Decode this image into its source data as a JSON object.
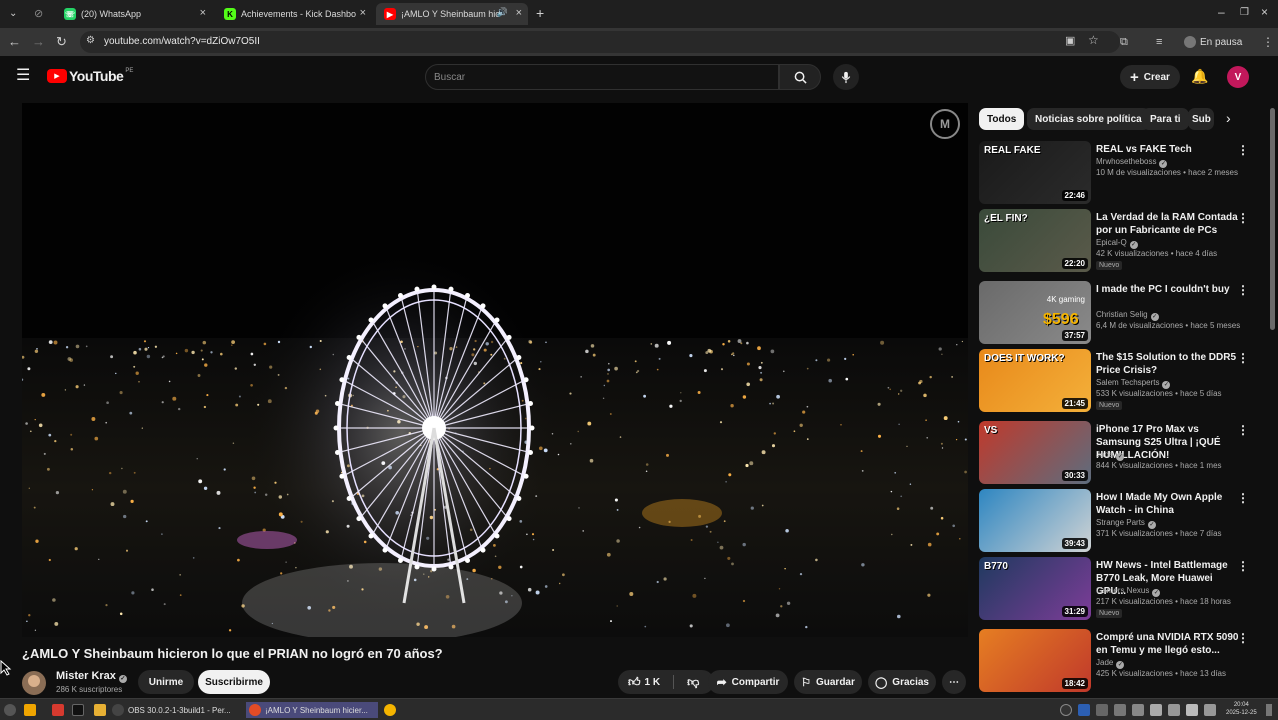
{
  "browser": {
    "tabs": [
      {
        "title": "(20) WhatsApp",
        "color": "#25d366"
      },
      {
        "title": "Achievements - Kick Dashbo",
        "color": "#53fc18"
      },
      {
        "title": "¡AMLO Y Sheinbaum hic",
        "color": "#ff0000",
        "active": true
      }
    ],
    "new_tab": "+",
    "url": "youtube.com/watch?v=dZiOw7O5II",
    "profile_status": "En pausa"
  },
  "youtube": {
    "logo_text": "YouTube",
    "logo_region": "PE",
    "search_placeholder": "Buscar",
    "create_label": "Crear",
    "avatar_letter": "V",
    "chips": [
      "Todos",
      "Noticias sobre política",
      "Para ti",
      "Sub"
    ]
  },
  "video": {
    "title": "¿AMLO Y Sheinbaum hicieron lo que el PRIAN no logró en 70 años?",
    "channel": "Mister Krax",
    "subscribers": "286 K suscriptores",
    "join_label": "Unirme",
    "subscribe_label": "Suscribirme",
    "likes": "1 K",
    "share_label": "Compartir",
    "save_label": "Guardar",
    "thanks_label": "Gracias"
  },
  "recommendations": [
    {
      "title": "REAL vs FAKE Tech",
      "channel": "Mrwhosetheboss",
      "meta": "10 M de visualizaciones • hace 2 meses",
      "duration": "22:46",
      "new": "",
      "thumb_text": "REAL FAKE",
      "thumb_colors": [
        "#1a1a1a",
        "#2b2b2b"
      ]
    },
    {
      "title": "La Verdad de la RAM Contada por un Fabricante de PCs",
      "channel": "Epical-Q",
      "meta": "42 K visualizaciones • hace 4 días",
      "duration": "22:20",
      "new": "Nuevo",
      "thumb_text": "¿EL FIN?",
      "thumb_colors": [
        "#3a4a3a",
        "#5a5a4a"
      ]
    },
    {
      "title": "I made the PC I couldn't buy",
      "channel": "Christian Selig",
      "meta": "6,4 M de visualizaciones • hace 5 meses",
      "duration": "37:57",
      "new": "",
      "thumb_text": "$596",
      "thumb_sub": "4K gaming",
      "thumb_colors": [
        "#6a6a6a",
        "#8a8a8a"
      ]
    },
    {
      "title": "The $15 Solution to the DDR5 Price Crisis?",
      "channel": "Salem Techsperts",
      "meta": "533 K visualizaciones • hace 5 días",
      "duration": "21:45",
      "new": "Nuevo",
      "thumb_text": "DOES IT WORK?",
      "thumb_colors": [
        "#e8891a",
        "#f4b03a"
      ]
    },
    {
      "title": "iPhone 17 Pro Max vs Samsung S25 Ultra | ¡QUÉ HUMILLACIÓN!",
      "channel": "Jade",
      "meta": "844 K visualizaciones • hace 1 mes",
      "duration": "30:33",
      "new": "",
      "thumb_text": "VS",
      "thumb_colors": [
        "#c0392b",
        "#5d6d7e"
      ]
    },
    {
      "title": "How I Made My Own Apple Watch - in China",
      "channel": "Strange Parts",
      "meta": "371 K visualizaciones • hace 7 días",
      "duration": "39:43",
      "new": "",
      "thumb_text": "",
      "thumb_colors": [
        "#2e86c1",
        "#d0d3d4"
      ]
    },
    {
      "title": "HW News - Intel Battlemage B770 Leak, More Huawei GPU...",
      "channel": "Gamers Nexus",
      "meta": "217 K visualizaciones • hace 18 horas",
      "duration": "31:29",
      "new": "Nuevo",
      "thumb_text": "B770",
      "thumb_colors": [
        "#1f3a5f",
        "#7d3c98"
      ]
    },
    {
      "title": "Compré una NVIDIA RTX 5090 en Temu y me llegó esto...",
      "channel": "Jade",
      "meta": "425 K visualizaciones • hace 13 días",
      "duration": "18:42",
      "new": "",
      "thumb_text": "",
      "thumb_colors": [
        "#e67e22",
        "#c0392b"
      ]
    }
  ],
  "taskbar": {
    "items": [
      "OBS 30.0.2-1-3build1 - Per...",
      "¡AMLO Y Sheinbaum hicier..."
    ],
    "time": "20:04",
    "date": "2025-12-25"
  }
}
